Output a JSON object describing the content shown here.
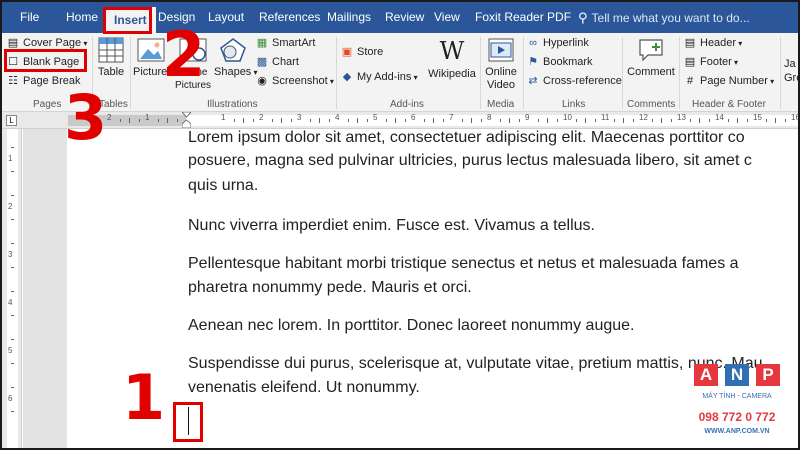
{
  "tabs": [
    {
      "label": "File"
    },
    {
      "label": "Home"
    },
    {
      "label": "Insert"
    },
    {
      "label": "Design"
    },
    {
      "label": "Layout"
    },
    {
      "label": "References"
    },
    {
      "label": "Mailings"
    },
    {
      "label": "Review"
    },
    {
      "label": "View"
    },
    {
      "label": "Foxit Reader PDF"
    }
  ],
  "tell_me": "Tell me what you want to do...",
  "ribbon": {
    "pages": {
      "label": "Pages",
      "items": [
        {
          "label": "Cover Page"
        },
        {
          "label": "Blank Page"
        },
        {
          "label": "Page Break"
        }
      ]
    },
    "tables": {
      "label": "Tables",
      "table": "Table"
    },
    "illustrations": {
      "label": "Illustrations",
      "pictures": "Pictures",
      "online_pictures": "Online Pictures",
      "shapes": "Shapes",
      "smartart": "SmartArt",
      "chart": "Chart",
      "screenshot": "Screenshot"
    },
    "addins": {
      "label": "Add-ins",
      "store": "Store",
      "my_addins": "My Add-ins",
      "wikipedia": "Wikipedia"
    },
    "media": {
      "label": "Media",
      "online_video": "Online Video"
    },
    "links": {
      "label": "Links",
      "hyperlink": "Hyperlink",
      "bookmark": "Bookmark",
      "cross_reference": "Cross-reference"
    },
    "comments": {
      "label": "Comments",
      "comment": "Comment"
    },
    "header_footer": {
      "label": "Header & Footer",
      "header": "Header",
      "footer": "Footer",
      "page_number": "Page Number"
    },
    "cutoff": "Ja\nGre"
  },
  "ruler_numbers": [
    "2",
    "1",
    "1",
    "2",
    "3",
    "4",
    "5",
    "6",
    "7",
    "8",
    "9",
    "10",
    "11",
    "12",
    "13",
    "14",
    "15",
    "16"
  ],
  "vruler_numbers": [
    "1",
    "2",
    "3",
    "4",
    "5",
    "6"
  ],
  "document": {
    "paragraphs": [
      "Lorem ipsum dolor sit amet, consectetuer adipiscing elit. Maecenas porttitor co",
      "posuere, magna sed pulvinar ultricies, purus lectus malesuada libero, sit amet c",
      "quis urna.",
      "Nunc viverra imperdiet enim. Fusce est. Vivamus a tellus.",
      "Pellentesque habitant morbi tristique senectus et netus      et malesuada fames a",
      "pharetra nonummy pede. Mauris et orci.",
      "Aenean nec lorem. In porttitor. Donec laoreet nonummy augue.",
      "Suspendisse dui purus, scelerisque at, vulputate vitae, pretium mattis, nunc. Mau",
      "venenatis eleifend. Ut nonummy."
    ]
  },
  "steps": [
    "1",
    "2",
    "3"
  ],
  "watermark": {
    "letters": [
      "A",
      "N",
      "P"
    ],
    "line1": "MÁY TÍNH - CAMERA",
    "phone": "098 772 0 772",
    "site": "WWW.ANP.COM.VN"
  },
  "colors": {
    "ribbon_blue": "#2b579a",
    "annotation_red": "#e10000"
  }
}
